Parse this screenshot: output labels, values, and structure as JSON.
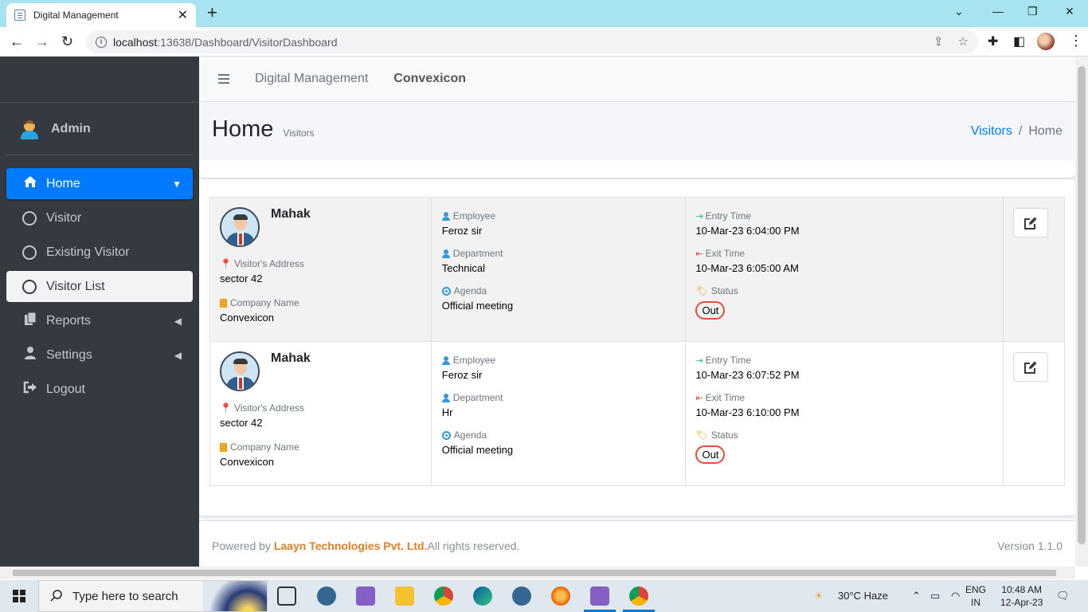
{
  "browser": {
    "tab_title": "Digital Management",
    "url_host": "localhost",
    "url_rest": ":13638/Dashboard/VisitorDashboard"
  },
  "sidebar": {
    "user_name": "Admin",
    "items": [
      {
        "label": "Home",
        "icon": "home-icon"
      },
      {
        "label": "Visitor",
        "icon": "circle-icon"
      },
      {
        "label": "Existing Visitor",
        "icon": "circle-icon"
      },
      {
        "label": "Visitor List",
        "icon": "circle-icon"
      },
      {
        "label": "Reports",
        "icon": "copy-icon"
      },
      {
        "label": "Settings",
        "icon": "user-icon"
      },
      {
        "label": "Logout",
        "icon": "sign-out-icon"
      }
    ]
  },
  "topnav": {
    "link1": "Digital Management",
    "link2": "Convexicon"
  },
  "header": {
    "title": "Home",
    "subtitle": "Visitors",
    "breadcrumb_link": "Visitors",
    "breadcrumb_current": "Home"
  },
  "labels": {
    "address": "Visitor's Address",
    "company": "Company Name",
    "employee": "Employee",
    "department": "Department",
    "agenda": "Agenda",
    "entry": "Entry Time",
    "exit": "Exit Time",
    "status": "Status"
  },
  "visitors": [
    {
      "name": "Mahak",
      "address": "sector 42",
      "company": "Convexicon",
      "employee": "Feroz sir",
      "department": "Technical",
      "agenda": "Official meeting",
      "entry_time": "10-Mar-23 6:04:00 PM",
      "exit_time": "10-Mar-23 6:05:00 AM",
      "status": "Out"
    },
    {
      "name": "Mahak",
      "address": "sector 42",
      "company": "Convexicon",
      "employee": "Feroz sir",
      "department": "Hr",
      "agenda": "Official meeting",
      "entry_time": "10-Mar-23 6:07:52 PM",
      "exit_time": "10-Mar-23 6:10:00 PM",
      "status": "Out"
    }
  ],
  "footer": {
    "prefix": "Powered by ",
    "company": "Laayn Technologies Pvt. Ltd.",
    "suffix": "All rights reserved.",
    "version": "Version 1.1.0"
  },
  "taskbar": {
    "search_placeholder": "Type here to search",
    "weather": "30°C  Haze",
    "lang1": "ENG",
    "lang2": "IN",
    "time": "10:48 AM",
    "date": "12-Apr-23"
  },
  "colors": {
    "primary": "#007bff",
    "sidebar": "#343a40",
    "accent": "#e67e22",
    "status_border": "#e74c3c"
  }
}
